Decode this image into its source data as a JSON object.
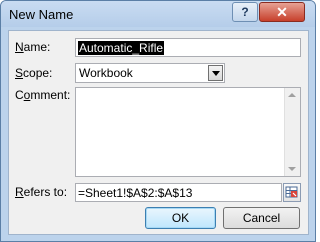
{
  "window": {
    "title": "New Name",
    "help_label": "?",
    "close_label": "✕"
  },
  "form": {
    "name_label_accel": "N",
    "name_label_rest": "ame:",
    "name_value": "Automatic_Rifle",
    "scope_label_accel": "S",
    "scope_label_rest": "cope:",
    "scope_value": "Workbook",
    "comment_label_prefix": "C",
    "comment_label_accel": "o",
    "comment_label_rest": "mment:",
    "comment_value": "",
    "refers_label_accel": "R",
    "refers_label_rest": "efers to:",
    "refers_value": "=Sheet1!$A$2:$A$13"
  },
  "buttons": {
    "ok": "OK",
    "cancel": "Cancel"
  },
  "icons": {
    "help": "help-icon",
    "close": "close-icon",
    "dropdown": "chevron-down-icon",
    "collapse": "range-select-icon"
  }
}
